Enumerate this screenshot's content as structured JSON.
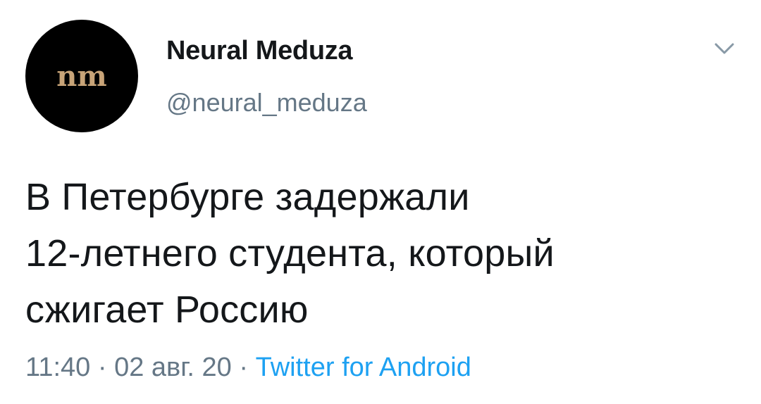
{
  "author": {
    "display_name": "Neural Meduza",
    "handle": "@neural_meduza",
    "avatar_text": "nm"
  },
  "tweet": {
    "lines": [
      "В Петербурге задержали",
      "12-летнего студента, который",
      "сжигает Россию"
    ]
  },
  "meta": {
    "time": "11:40",
    "date": "02 авг. 20",
    "separator": "·",
    "source": "Twitter for Android"
  },
  "icons": {
    "menu": "chevron-down-icon",
    "avatar": "neural-meduza-logo"
  },
  "colors": {
    "text": "#14171a",
    "secondary": "#657786",
    "link": "#1da1f2",
    "avatar_bg": "#000000",
    "logo": "#c8a478"
  }
}
